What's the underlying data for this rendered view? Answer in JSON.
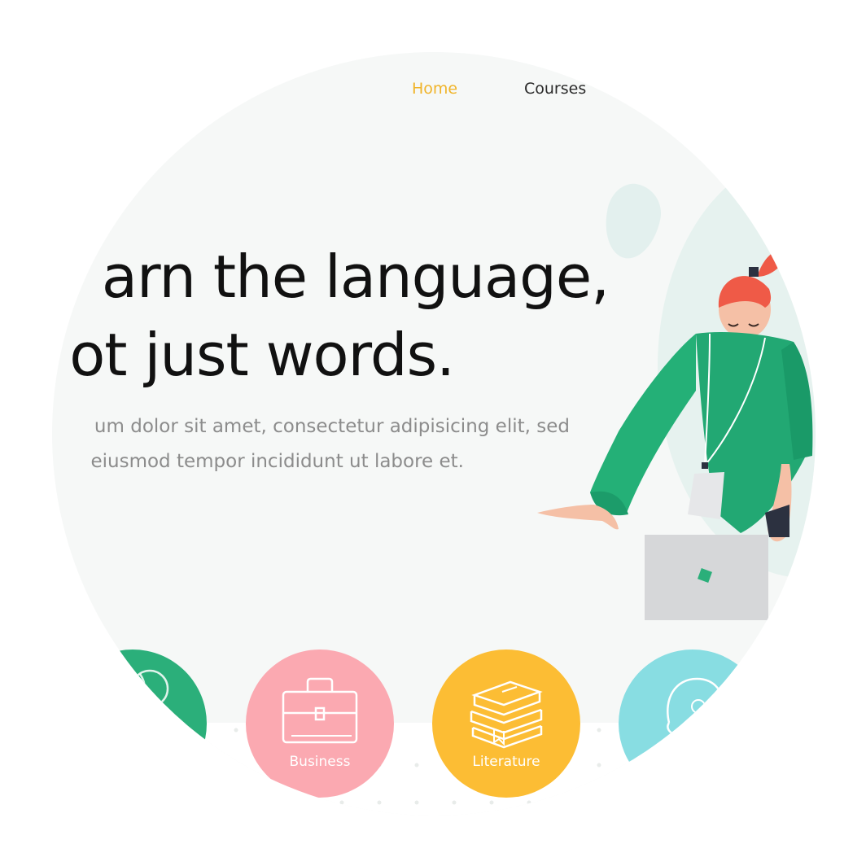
{
  "nav": {
    "items": [
      {
        "label": "Home",
        "active": true
      },
      {
        "label": "Courses",
        "active": false
      }
    ],
    "active_color": "#f0b429"
  },
  "hero": {
    "headline_line1": "arn the language,",
    "headline_line2": "ot just words.",
    "sub_line1": "um dolor sit amet, consectetur adipisicing elit, sed",
    "sub_line2": "eiusmod tempor incididunt ut labore et."
  },
  "categories": [
    {
      "label": "",
      "color": "#2baf7a",
      "icon": "globe-icon"
    },
    {
      "label": "Business",
      "color": "#fba9b1",
      "icon": "briefcase-icon"
    },
    {
      "label": "Literature",
      "color": "#fcbd34",
      "icon": "books-icon"
    },
    {
      "label": "",
      "color": "#88dde2",
      "icon": "head-icon"
    }
  ]
}
